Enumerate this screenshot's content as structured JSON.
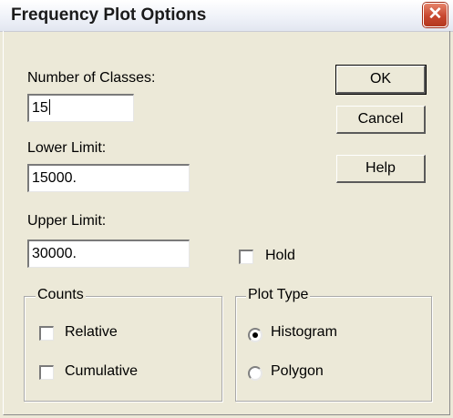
{
  "window": {
    "title": "Frequency Plot Options",
    "close_symbol": "✕"
  },
  "fields": {
    "num_classes": {
      "label": "Number of Classes:",
      "value": "15"
    },
    "lower_limit": {
      "label": "Lower Limit:",
      "value": "15000."
    },
    "upper_limit": {
      "label": "Upper Limit:",
      "value": "30000."
    }
  },
  "buttons": {
    "ok": "OK",
    "cancel": "Cancel",
    "help": "Help"
  },
  "hold": {
    "label": "Hold",
    "checked": false
  },
  "counts": {
    "title": "Counts",
    "relative": {
      "label": "Relative",
      "checked": false
    },
    "cumulative": {
      "label": "Cumulative",
      "checked": false
    }
  },
  "plot_type": {
    "title": "Plot Type",
    "histogram": {
      "label": "Histogram",
      "selected": true
    },
    "polygon": {
      "label": "Polygon",
      "selected": false
    }
  }
}
